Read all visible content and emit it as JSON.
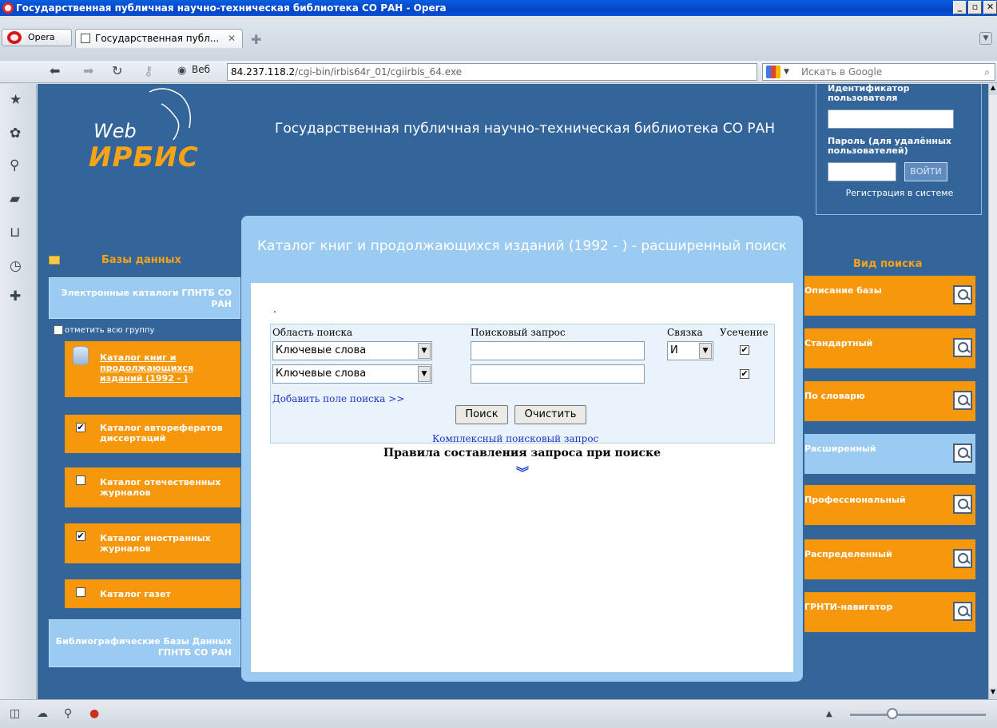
{
  "window": {
    "title": "Государственная публичная научно-техническая библиотека СО РАН - Opera"
  },
  "browser": {
    "opera_button": "Opera",
    "tab_title": "Государственная публ...",
    "web_label": "Веб",
    "url_host": "84.237.118.2",
    "url_path": "/cgi-bin/irbis64r_01/cgiirbis_64.exe",
    "search_placeholder": "Искать в Google"
  },
  "site": {
    "logo_web": "Web",
    "logo_irbis": "ИРБИС",
    "title": "Государственная публичная научно-техническая библиотека СО РАН"
  },
  "login": {
    "user_label": "Идентификатор пользователя",
    "password_label": "Пароль (для удалённых пользователей)",
    "login_button": "ВОЙТИ",
    "register_link": "Регистрация в системе"
  },
  "databases": {
    "heading": "Базы данных",
    "group1": "Электронные каталоги ГПНТБ СО РАН",
    "mark_all": "отметить всю группу",
    "items": [
      {
        "label": "Каталог книг и продолжающихся изданий (1992 - )",
        "checked": null
      },
      {
        "label": "Каталог авторефератов диссертаций",
        "checked": true
      },
      {
        "label": "Каталог отечественных журналов",
        "checked": false
      },
      {
        "label": "Каталог иностранных журналов",
        "checked": true
      },
      {
        "label": "Каталог газет",
        "checked": false
      }
    ],
    "group2": "Библиографические Базы Данных ГПНТБ СО РАН"
  },
  "search": {
    "heading": "Каталог книг и продолжающихся изданий (1992 - ) - расширенный поиск",
    "dot": ".",
    "col_area": "Область поиска",
    "col_query": "Поисковый запрос",
    "col_link": "Связка",
    "col_trunc": "Усечение",
    "row1_area": "Ключевые слова",
    "row1_link": "И",
    "row2_area": "Ключевые слова",
    "check_mark": "✔",
    "add_field": "Добавить поле поиска >>",
    "search_button": "Поиск",
    "clear_button": "Очистить",
    "complex_query": "Комплексный поисковый запрос",
    "rules": "Правила составления запроса при поиске"
  },
  "search_types": {
    "heading": "Вид поиска",
    "items": [
      "Описание базы",
      "Стандартный",
      "По словарю",
      "Расширенный",
      "Профессиональный",
      "Распределенный",
      "ГРНТИ-навигатор"
    ],
    "active": "Расширенный"
  }
}
